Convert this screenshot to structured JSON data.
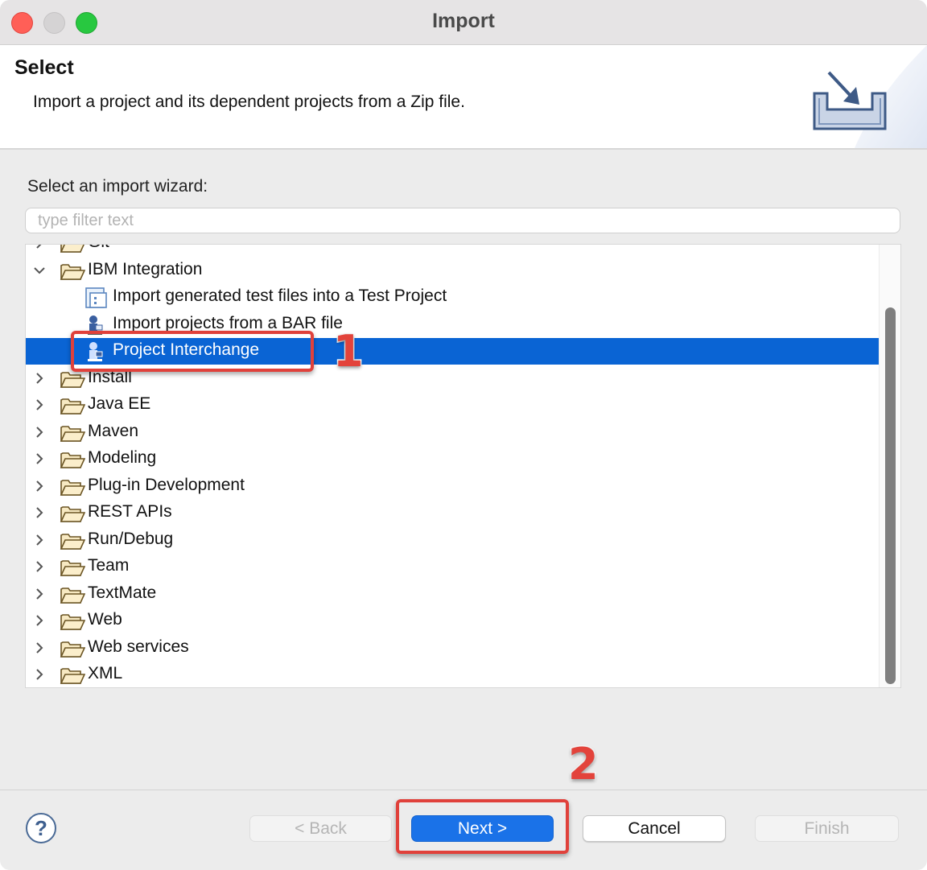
{
  "window": {
    "title": "Import"
  },
  "header": {
    "title": "Select",
    "description": "Import a project and its dependent projects from a Zip file."
  },
  "wizard": {
    "prompt": "Select an import wizard:",
    "filter_placeholder": "type filter text",
    "filter_value": "",
    "items": [
      {
        "label": "Git",
        "type": "folder",
        "expanded": false
      },
      {
        "label": "IBM Integration",
        "type": "folder",
        "expanded": true
      },
      {
        "label": "Import generated test files into a Test Project",
        "type": "leaf",
        "icon": "test-files-icon"
      },
      {
        "label": "Import projects from a BAR file",
        "type": "leaf",
        "icon": "integration-project-icon"
      },
      {
        "label": "Project Interchange",
        "type": "leaf",
        "icon": "integration-project-icon",
        "selected": true
      },
      {
        "label": "Install",
        "type": "folder",
        "expanded": false
      },
      {
        "label": "Java EE",
        "type": "folder",
        "expanded": false
      },
      {
        "label": "Maven",
        "type": "folder",
        "expanded": false
      },
      {
        "label": "Modeling",
        "type": "folder",
        "expanded": false
      },
      {
        "label": "Plug-in Development",
        "type": "folder",
        "expanded": false
      },
      {
        "label": "REST APIs",
        "type": "folder",
        "expanded": false
      },
      {
        "label": "Run/Debug",
        "type": "folder",
        "expanded": false
      },
      {
        "label": "Team",
        "type": "folder",
        "expanded": false
      },
      {
        "label": "TextMate",
        "type": "folder",
        "expanded": false
      },
      {
        "label": "Web",
        "type": "folder",
        "expanded": false
      },
      {
        "label": "Web services",
        "type": "folder",
        "expanded": false
      },
      {
        "label": "XML",
        "type": "folder",
        "expanded": false
      }
    ]
  },
  "buttons": {
    "help": "?",
    "back": "< Back",
    "next": "Next >",
    "cancel": "Cancel",
    "finish": "Finish"
  },
  "annotations": {
    "step1": "1",
    "step2": "2"
  },
  "colors": {
    "selection": "#0a64d4",
    "primary_button": "#1a72e8",
    "callout": "#e0413b"
  }
}
